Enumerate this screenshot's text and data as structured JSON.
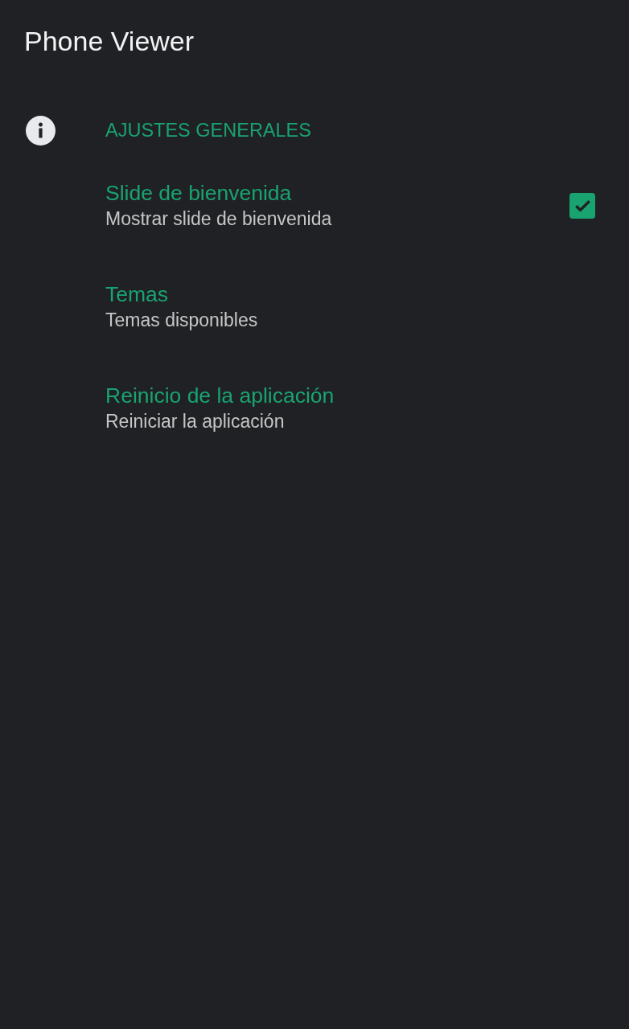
{
  "app_bar": {
    "title": "Phone Viewer"
  },
  "section": {
    "title": "AJUSTES GENERALES"
  },
  "preferences": [
    {
      "kind": "checkbox",
      "title": "Slide de bienvenida",
      "summary": "Mostrar slide de bienvenida",
      "checked": true
    },
    {
      "kind": "plain",
      "title": "Temas",
      "summary": "Temas disponibles"
    },
    {
      "kind": "plain",
      "title": "Reinicio de la aplicación",
      "summary": "Reiniciar la aplicación"
    }
  ]
}
